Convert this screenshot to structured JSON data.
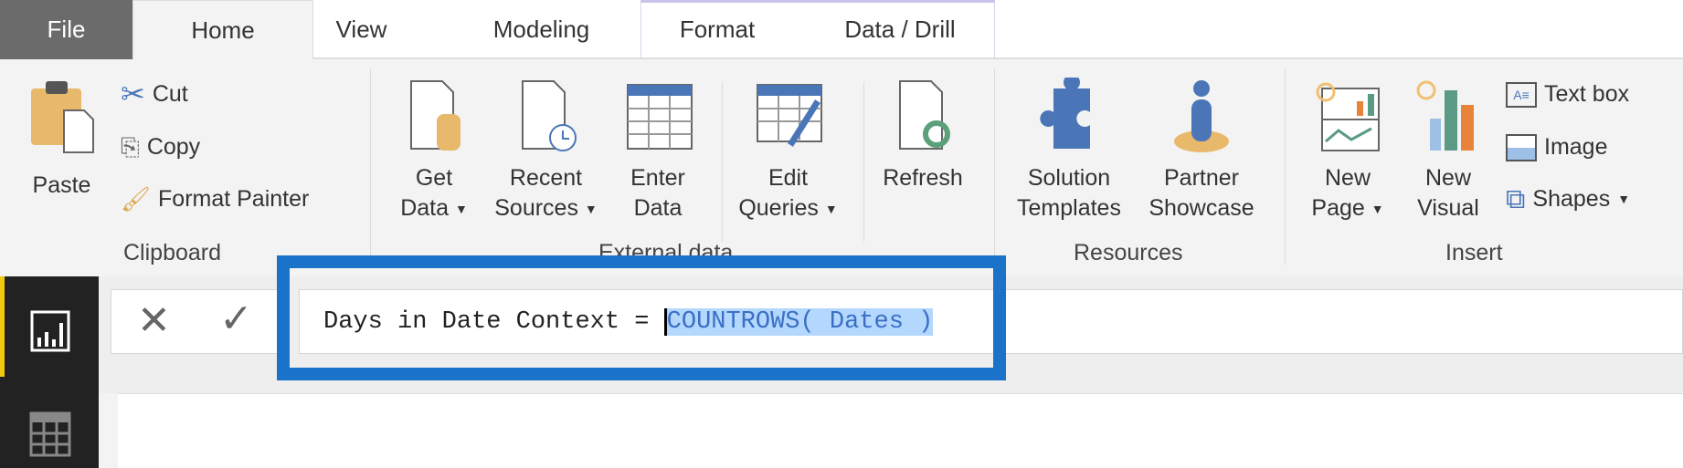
{
  "tabs": [
    "File",
    "Home",
    "View",
    "Modeling",
    "Format",
    "Data / Drill"
  ],
  "clipboard": {
    "paste": "Paste",
    "cut": "Cut",
    "copy": "Copy",
    "format_painter": "Format Painter",
    "group": "Clipboard"
  },
  "external": {
    "get_data": [
      "Get",
      "Data"
    ],
    "recent": [
      "Recent",
      "Sources"
    ],
    "enter": [
      "Enter",
      "Data"
    ],
    "edit": [
      "Edit",
      "Queries"
    ],
    "refresh": "Refresh",
    "group": "External data"
  },
  "resources": {
    "solution": [
      "Solution",
      "Templates"
    ],
    "partner": [
      "Partner",
      "Showcase"
    ],
    "group": "Resources"
  },
  "insert": {
    "new_page": [
      "New",
      "Page"
    ],
    "new_visual": [
      "New",
      "Visual"
    ],
    "text_box": "Text box",
    "image": "Image",
    "shapes": "Shapes",
    "group": "Insert"
  },
  "formula": {
    "prefix": "Days in Date Context = ",
    "selected": "COUNTROWS( Dates )"
  },
  "colors": {
    "highlight": "#1a73c9",
    "accent": "#f2c811",
    "selection": "#b3d7fd"
  }
}
